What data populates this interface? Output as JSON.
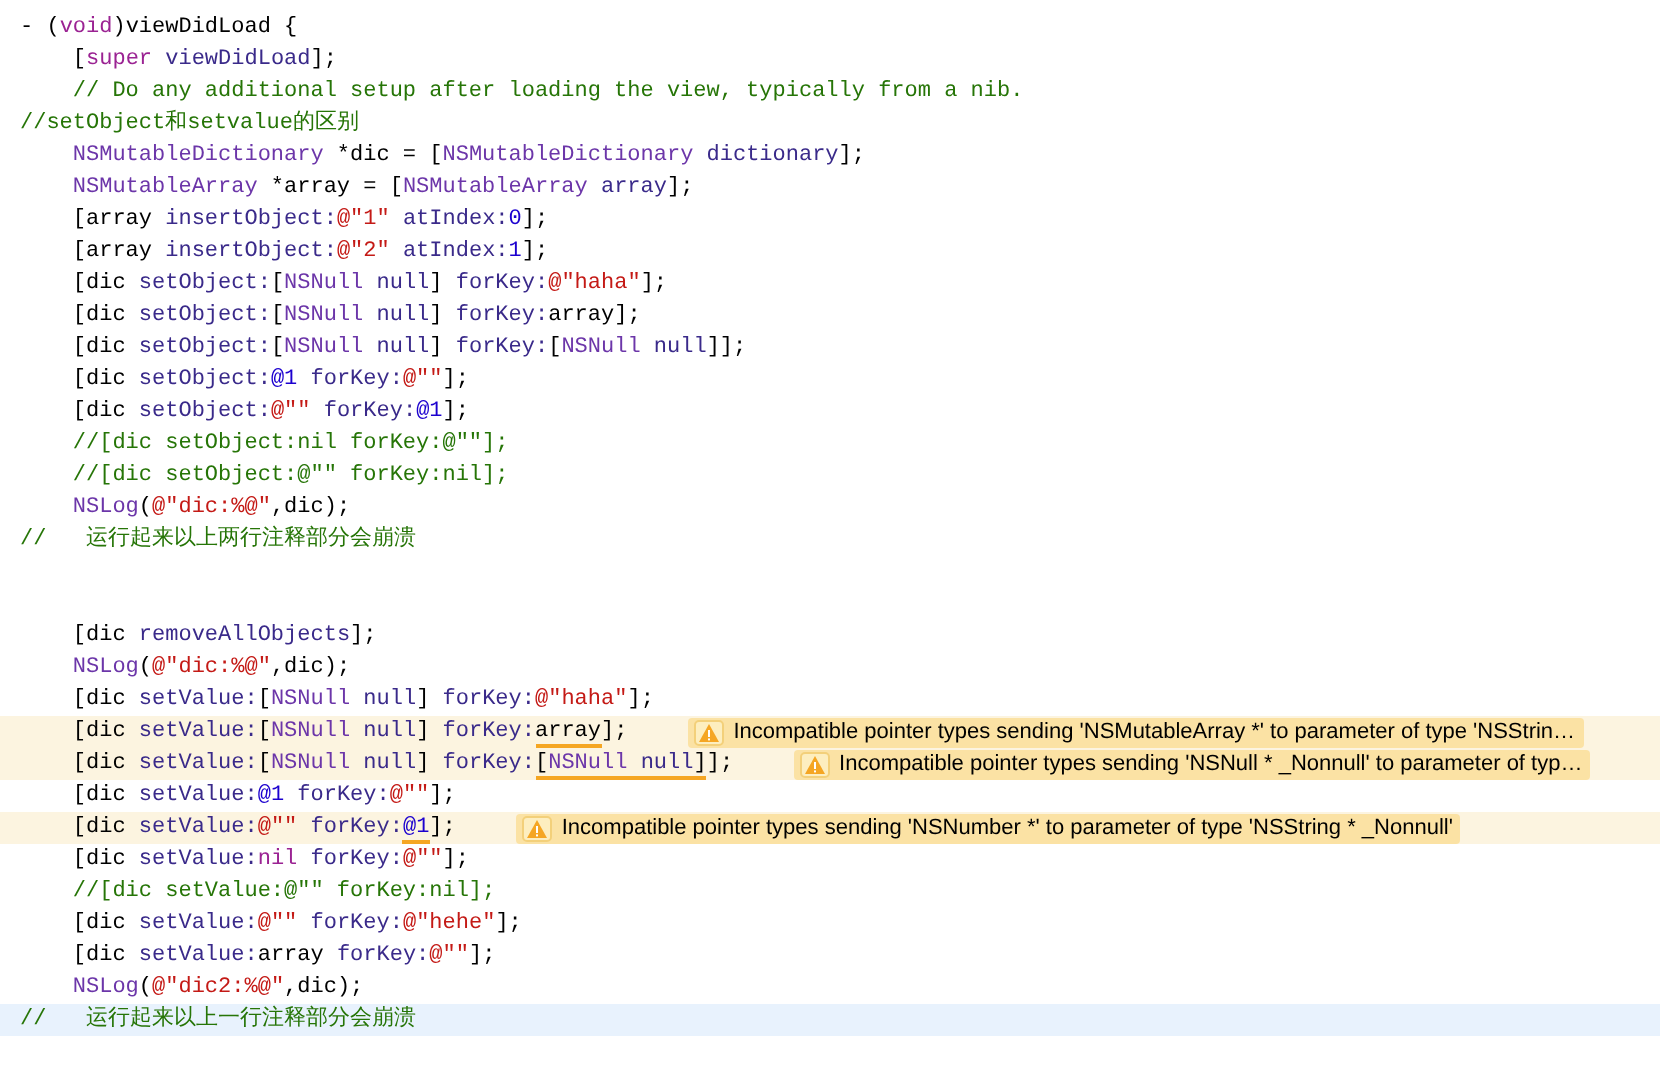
{
  "editor": {
    "lines": [
      {
        "kind": "code",
        "tokens": [
          {
            "kind": "plain",
            "text": "- ("
          },
          {
            "kind": "keyword",
            "text": "void"
          },
          {
            "kind": "plain",
            "text": ")viewDidLoad {"
          }
        ]
      },
      {
        "kind": "code",
        "tokens": [
          {
            "kind": "plain",
            "text": "    ["
          },
          {
            "kind": "keyword",
            "text": "super"
          },
          {
            "kind": "method",
            "text": " viewDidLoad"
          },
          {
            "kind": "plain",
            "text": "];"
          }
        ]
      },
      {
        "kind": "code",
        "tokens": [
          {
            "kind": "comment",
            "text": "    // Do any additional setup after loading the view, typically from a nib."
          }
        ]
      },
      {
        "kind": "code",
        "tokens": [
          {
            "kind": "comment",
            "text": "//setObject和setvalue的区别"
          }
        ]
      },
      {
        "kind": "code",
        "tokens": [
          {
            "kind": "class",
            "text": "    NSMutableDictionary"
          },
          {
            "kind": "plain",
            "text": " *dic = ["
          },
          {
            "kind": "class",
            "text": "NSMutableDictionary"
          },
          {
            "kind": "method",
            "text": " dictionary"
          },
          {
            "kind": "plain",
            "text": "];"
          }
        ]
      },
      {
        "kind": "code",
        "tokens": [
          {
            "kind": "class",
            "text": "    NSMutableArray"
          },
          {
            "kind": "plain",
            "text": " *array = ["
          },
          {
            "kind": "class",
            "text": "NSMutableArray"
          },
          {
            "kind": "method",
            "text": " array"
          },
          {
            "kind": "plain",
            "text": "];"
          }
        ]
      },
      {
        "kind": "code",
        "tokens": [
          {
            "kind": "plain",
            "text": "    [array "
          },
          {
            "kind": "method",
            "text": "insertObject:"
          },
          {
            "kind": "string",
            "text": "@\"1\""
          },
          {
            "kind": "method",
            "text": " atIndex:"
          },
          {
            "kind": "number",
            "text": "0"
          },
          {
            "kind": "plain",
            "text": "];"
          }
        ]
      },
      {
        "kind": "code",
        "tokens": [
          {
            "kind": "plain",
            "text": "    [array "
          },
          {
            "kind": "method",
            "text": "insertObject:"
          },
          {
            "kind": "string",
            "text": "@\"2\""
          },
          {
            "kind": "method",
            "text": " atIndex:"
          },
          {
            "kind": "number",
            "text": "1"
          },
          {
            "kind": "plain",
            "text": "];"
          }
        ]
      },
      {
        "kind": "code",
        "tokens": [
          {
            "kind": "plain",
            "text": "    [dic "
          },
          {
            "kind": "method",
            "text": "setObject:"
          },
          {
            "kind": "plain",
            "text": "["
          },
          {
            "kind": "class",
            "text": "NSNull"
          },
          {
            "kind": "method",
            "text": " null"
          },
          {
            "kind": "plain",
            "text": "] "
          },
          {
            "kind": "method",
            "text": "forKey:"
          },
          {
            "kind": "string",
            "text": "@\"haha\""
          },
          {
            "kind": "plain",
            "text": "];"
          }
        ]
      },
      {
        "kind": "code",
        "tokens": [
          {
            "kind": "plain",
            "text": "    [dic "
          },
          {
            "kind": "method",
            "text": "setObject:"
          },
          {
            "kind": "plain",
            "text": "["
          },
          {
            "kind": "class",
            "text": "NSNull"
          },
          {
            "kind": "method",
            "text": " null"
          },
          {
            "kind": "plain",
            "text": "] "
          },
          {
            "kind": "method",
            "text": "forKey:"
          },
          {
            "kind": "plain",
            "text": "array];"
          }
        ]
      },
      {
        "kind": "code",
        "tokens": [
          {
            "kind": "plain",
            "text": "    [dic "
          },
          {
            "kind": "method",
            "text": "setObject:"
          },
          {
            "kind": "plain",
            "text": "["
          },
          {
            "kind": "class",
            "text": "NSNull"
          },
          {
            "kind": "method",
            "text": " null"
          },
          {
            "kind": "plain",
            "text": "] "
          },
          {
            "kind": "method",
            "text": "forKey:"
          },
          {
            "kind": "plain",
            "text": "["
          },
          {
            "kind": "class",
            "text": "NSNull"
          },
          {
            "kind": "method",
            "text": " null"
          },
          {
            "kind": "plain",
            "text": "]];"
          }
        ]
      },
      {
        "kind": "code",
        "tokens": [
          {
            "kind": "plain",
            "text": "    [dic "
          },
          {
            "kind": "method",
            "text": "setObject:"
          },
          {
            "kind": "number",
            "text": "@1"
          },
          {
            "kind": "method",
            "text": " forKey:"
          },
          {
            "kind": "string",
            "text": "@\"\""
          },
          {
            "kind": "plain",
            "text": "];"
          }
        ]
      },
      {
        "kind": "code",
        "tokens": [
          {
            "kind": "plain",
            "text": "    [dic "
          },
          {
            "kind": "method",
            "text": "setObject:"
          },
          {
            "kind": "string",
            "text": "@\"\""
          },
          {
            "kind": "method",
            "text": " forKey:"
          },
          {
            "kind": "number",
            "text": "@1"
          },
          {
            "kind": "plain",
            "text": "];"
          }
        ]
      },
      {
        "kind": "code",
        "tokens": [
          {
            "kind": "comment",
            "text": "    //[dic setObject:nil forKey:@\"\"];"
          }
        ]
      },
      {
        "kind": "code",
        "tokens": [
          {
            "kind": "comment",
            "text": "    //[dic setObject:@\"\" forKey:nil];"
          }
        ]
      },
      {
        "kind": "code",
        "tokens": [
          {
            "kind": "class",
            "text": "    NSLog"
          },
          {
            "kind": "plain",
            "text": "("
          },
          {
            "kind": "string",
            "text": "@\"dic:%@\""
          },
          {
            "kind": "plain",
            "text": ",dic);"
          }
        ]
      },
      {
        "kind": "code",
        "tokens": [
          {
            "kind": "comment",
            "text": "//   运行起来以上两行注释部分会崩溃"
          }
        ]
      },
      {
        "kind": "blank"
      },
      {
        "kind": "blank"
      },
      {
        "kind": "code",
        "tokens": [
          {
            "kind": "plain",
            "text": "    [dic "
          },
          {
            "kind": "method",
            "text": "removeAllObjects"
          },
          {
            "kind": "plain",
            "text": "];"
          }
        ]
      },
      {
        "kind": "code",
        "tokens": [
          {
            "kind": "class",
            "text": "    NSLog"
          },
          {
            "kind": "plain",
            "text": "("
          },
          {
            "kind": "string",
            "text": "@\"dic:%@\""
          },
          {
            "kind": "plain",
            "text": ",dic);"
          }
        ]
      },
      {
        "kind": "code",
        "tokens": [
          {
            "kind": "plain",
            "text": "    [dic "
          },
          {
            "kind": "method",
            "text": "setValue:"
          },
          {
            "kind": "plain",
            "text": "["
          },
          {
            "kind": "class",
            "text": "NSNull"
          },
          {
            "kind": "method",
            "text": " null"
          },
          {
            "kind": "plain",
            "text": "] "
          },
          {
            "kind": "method",
            "text": "forKey:"
          },
          {
            "kind": "string",
            "text": "@\"haha\""
          },
          {
            "kind": "plain",
            "text": "];"
          }
        ]
      },
      {
        "kind": "code",
        "warning": "Incompatible pointer types sending 'NSMutableArray *' to parameter of type 'NSStrin…",
        "tokens": [
          {
            "kind": "plain",
            "text": "    [dic "
          },
          {
            "kind": "method",
            "text": "setValue:"
          },
          {
            "kind": "plain",
            "text": "["
          },
          {
            "kind": "class",
            "text": "NSNull"
          },
          {
            "kind": "method",
            "text": " null"
          },
          {
            "kind": "plain",
            "text": "] "
          },
          {
            "kind": "method",
            "text": "forKey:"
          },
          {
            "kind": "plain",
            "text": "array",
            "flagged": true
          },
          {
            "kind": "plain",
            "text": "];"
          }
        ]
      },
      {
        "kind": "code",
        "warning": "Incompatible pointer types sending 'NSNull * _Nonnull' to parameter of typ…",
        "tokens": [
          {
            "kind": "plain",
            "text": "    [dic "
          },
          {
            "kind": "method",
            "text": "setValue:"
          },
          {
            "kind": "plain",
            "text": "["
          },
          {
            "kind": "class",
            "text": "NSNull"
          },
          {
            "kind": "method",
            "text": " null"
          },
          {
            "kind": "plain",
            "text": "] "
          },
          {
            "kind": "method",
            "text": "forKey:"
          },
          {
            "kind": "plain",
            "text": "[",
            "flagged": true
          },
          {
            "kind": "class",
            "text": "NSNull",
            "flagged": true
          },
          {
            "kind": "method",
            "text": " null",
            "flagged": true
          },
          {
            "kind": "plain",
            "text": "]",
            "flagged": true
          },
          {
            "kind": "plain",
            "text": "];"
          }
        ]
      },
      {
        "kind": "code",
        "tokens": [
          {
            "kind": "plain",
            "text": "    [dic "
          },
          {
            "kind": "method",
            "text": "setValue:"
          },
          {
            "kind": "number",
            "text": "@1"
          },
          {
            "kind": "method",
            "text": " forKey:"
          },
          {
            "kind": "string",
            "text": "@\"\""
          },
          {
            "kind": "plain",
            "text": "];"
          }
        ]
      },
      {
        "kind": "code",
        "warning": "Incompatible pointer types sending 'NSNumber *' to parameter of type 'NSString * _Nonnull'",
        "tokens": [
          {
            "kind": "plain",
            "text": "    [dic "
          },
          {
            "kind": "method",
            "text": "setValue:"
          },
          {
            "kind": "string",
            "text": "@\"\""
          },
          {
            "kind": "method",
            "text": " forKey:"
          },
          {
            "kind": "number",
            "text": "@1",
            "flagged": true
          },
          {
            "kind": "plain",
            "text": "];"
          }
        ]
      },
      {
        "kind": "code",
        "tokens": [
          {
            "kind": "plain",
            "text": "    [dic "
          },
          {
            "kind": "method",
            "text": "setValue:"
          },
          {
            "kind": "keyword",
            "text": "nil"
          },
          {
            "kind": "method",
            "text": " forKey:"
          },
          {
            "kind": "string",
            "text": "@\"\""
          },
          {
            "kind": "plain",
            "text": "];"
          }
        ]
      },
      {
        "kind": "code",
        "tokens": [
          {
            "kind": "comment",
            "text": "    //[dic setValue:@\"\" forKey:nil];"
          }
        ]
      },
      {
        "kind": "code",
        "tokens": [
          {
            "kind": "plain",
            "text": "    [dic "
          },
          {
            "kind": "method",
            "text": "setValue:"
          },
          {
            "kind": "string",
            "text": "@\"\""
          },
          {
            "kind": "method",
            "text": " forKey:"
          },
          {
            "kind": "string",
            "text": "@\"hehe\""
          },
          {
            "kind": "plain",
            "text": "];"
          }
        ]
      },
      {
        "kind": "code",
        "tokens": [
          {
            "kind": "plain",
            "text": "    [dic "
          },
          {
            "kind": "method",
            "text": "setValue:"
          },
          {
            "kind": "plain",
            "text": "array "
          },
          {
            "kind": "method",
            "text": "forKey:"
          },
          {
            "kind": "string",
            "text": "@\"\""
          },
          {
            "kind": "plain",
            "text": "];"
          }
        ]
      },
      {
        "kind": "code",
        "tokens": [
          {
            "kind": "class",
            "text": "    NSLog"
          },
          {
            "kind": "plain",
            "text": "("
          },
          {
            "kind": "string",
            "text": "@\"dic2:%@\""
          },
          {
            "kind": "plain",
            "text": ",dic);"
          }
        ]
      },
      {
        "kind": "code",
        "current": true,
        "tokens": [
          {
            "kind": "comment",
            "text": "//   运行起来以上一行注释部分会崩溃"
          }
        ]
      }
    ]
  }
}
